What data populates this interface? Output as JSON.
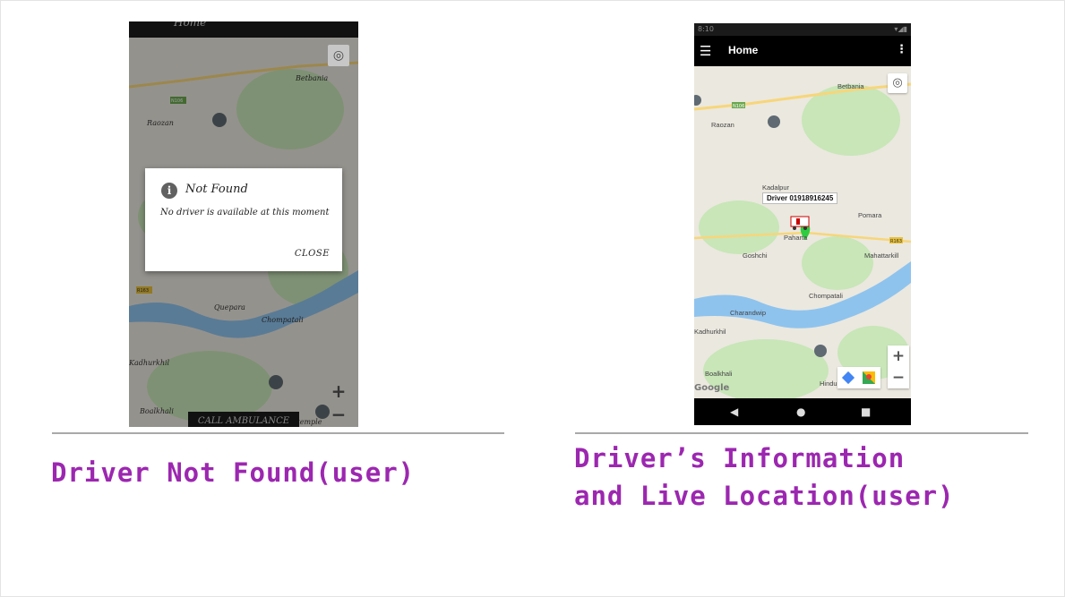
{
  "left_screen": {
    "app_title": "Home",
    "map_labels": [
      "Betbania",
      "Raozan",
      "Quepara",
      "Chompatali",
      "Kadhurkhil",
      "Boalkhali",
      "Hindu temple"
    ],
    "road_label": "N106",
    "road_label2": "R163",
    "dialog": {
      "title": "Not Found",
      "message": "No driver is available at this moment",
      "close_label": "CLOSE"
    },
    "call_button": "CALL AMBULANCE",
    "zoom_in": "+",
    "zoom_out": "−"
  },
  "right_screen": {
    "status_time": "8:10",
    "app_title": "Home",
    "map_labels": [
      "Betbania",
      "Raozan",
      "Kadalpur",
      "Pomara",
      "Paharta",
      "Goshchi",
      "Mahattarkill",
      "Chompatali",
      "Charandwip",
      "Kadhurkhil",
      "Boalkhali",
      "Hindu"
    ],
    "road_label": "N106",
    "road_label2": "R163",
    "driver_label": "Driver 01918916245",
    "google_label": "Google",
    "zoom_in": "+",
    "zoom_out": "−"
  },
  "captions": {
    "left": "Driver Not Found(user)",
    "right_line1": "Driver’s Information",
    "right_line2": "and Live Location(user)"
  },
  "colors": {
    "caption": "#9c27b0",
    "river": "#8ec3ee",
    "map_bg": "#ebe8df",
    "green": "#c8e6b8"
  }
}
